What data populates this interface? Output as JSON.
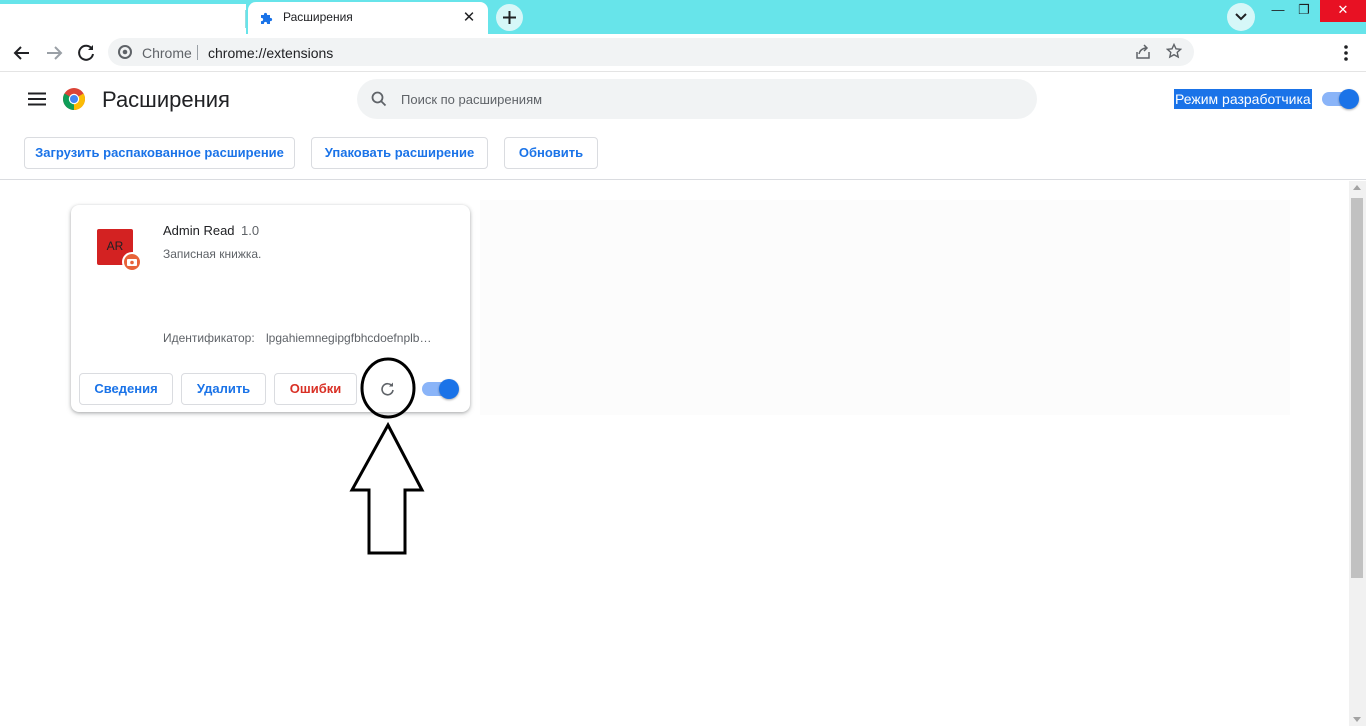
{
  "tabs": [
    {
      "title": "Расширения",
      "icon": "puzzle-icon",
      "active": true
    }
  ],
  "window": {
    "tab_bar_color": "#67e4ea",
    "minimize": "—",
    "maximize": "❐",
    "close": "✕"
  },
  "omnibox": {
    "site_name": "Chrome",
    "url": "chrome://extensions"
  },
  "extensions_page": {
    "title": "Расширения",
    "search_placeholder": "Поиск по расширениям",
    "dev_mode_label": "Режим разработчика",
    "dev_mode_enabled": true,
    "actions": {
      "load_unpacked": "Загрузить распакованное расширение",
      "pack": "Упаковать расширение",
      "update": "Обновить"
    }
  },
  "extension": {
    "icon_text": "AR",
    "name": "Admin Read",
    "version": "1.0",
    "description": "Записная книжка.",
    "id_label": "Идентификатор:",
    "id": "lpgahiemnegipgfbhcdoefnplb…",
    "details_label": "Сведения",
    "remove_label": "Удалить",
    "errors_label": "Ошибки",
    "enabled": true
  },
  "colors": {
    "accent": "#1a73e8",
    "error": "#d93025",
    "toggle_track": "#8ab4f8"
  }
}
